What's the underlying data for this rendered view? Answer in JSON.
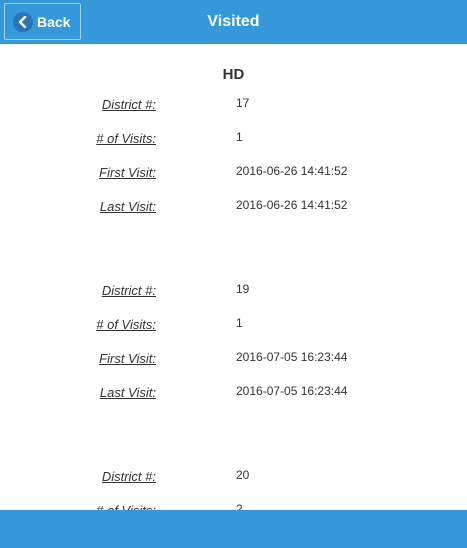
{
  "header": {
    "back_label": "Back",
    "title": "Visited"
  },
  "section": {
    "heading": "HD"
  },
  "labels": {
    "district": "District #:",
    "visits": "# of Visits:",
    "first_visit": "First Visit:",
    "last_visit": "Last Visit:"
  },
  "records": [
    {
      "district": "17",
      "visits": "1",
      "first_visit": "2016-06-26 14:41:52",
      "last_visit": "2016-06-26 14:41:52"
    },
    {
      "district": "19",
      "visits": "1",
      "first_visit": "2016-07-05 16:23:44",
      "last_visit": "2016-07-05 16:23:44"
    },
    {
      "district": "20",
      "visits": "2"
    }
  ],
  "colors": {
    "accent": "#3498db",
    "text": "#333333",
    "background": "#ffffff"
  }
}
